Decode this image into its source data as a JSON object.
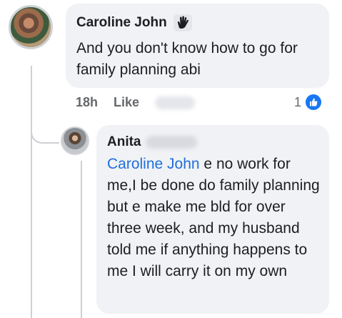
{
  "comment": {
    "author": "Caroline John",
    "author_badge_icon": "waving-hand-icon",
    "text": "And you don't know how to go for family planning abi",
    "timestamp": "18h",
    "like_label": "Like",
    "reaction_count": "1",
    "reaction_icon": "like-thumb-icon"
  },
  "reply": {
    "author": "Anita",
    "mention": "Caroline John",
    "text": " e no work for me,I be done do family planning but e make me bld for over three week, and my husband told me if anything happens to me I will carry it on my own"
  },
  "colors": {
    "bubble": "#f0f2f5",
    "mention": "#216fdb",
    "meta": "#65676b",
    "like_blue": "#1877f2"
  }
}
